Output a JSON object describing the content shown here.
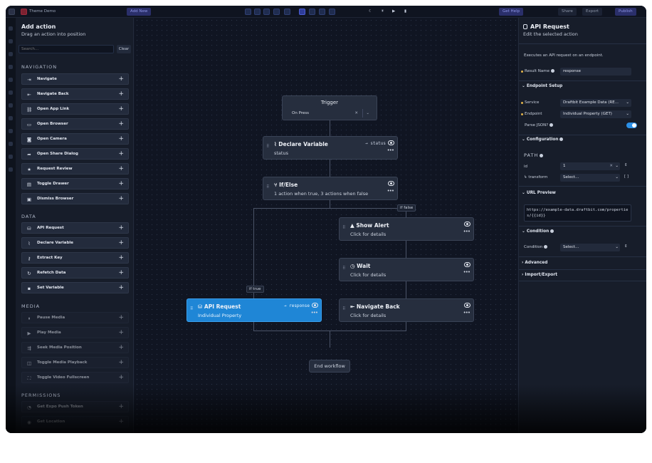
{
  "topbar": {
    "app_name": "Theme Demo",
    "add_new": "Add New",
    "get_help": "Get Help",
    "share": "Share",
    "export": "Export",
    "publish": "Publish"
  },
  "left_panel": {
    "title": "Add action",
    "subtitle": "Drag an action into position",
    "search_placeholder": "Search...",
    "clear_label": "Clear",
    "sections": {
      "navigation": "NAVIGATION",
      "data": "DATA",
      "media": "MEDIA",
      "permissions": "PERMISSIONS"
    },
    "navigation_items": [
      {
        "label": "Navigate",
        "icon": "arrow-right-bar-icon"
      },
      {
        "label": "Navigate Back",
        "icon": "arrow-left-bar-icon"
      },
      {
        "label": "Open App Link",
        "icon": "link-icon"
      },
      {
        "label": "Open Browser",
        "icon": "browser-icon"
      },
      {
        "label": "Open Camera",
        "icon": "camera-icon"
      },
      {
        "label": "Open Share Dialog",
        "icon": "share-icon"
      },
      {
        "label": "Request Review",
        "icon": "star-icon"
      },
      {
        "label": "Toggle Drawer",
        "icon": "drawer-icon"
      },
      {
        "label": "Dismiss Browser",
        "icon": "dismiss-icon"
      }
    ],
    "data_items": [
      {
        "label": "API Request",
        "icon": "database-icon"
      },
      {
        "label": "Declare Variable",
        "icon": "paperclip-icon"
      },
      {
        "label": "Extract Key",
        "icon": "key-icon"
      },
      {
        "label": "Refetch Data",
        "icon": "refresh-icon"
      },
      {
        "label": "Set Variable",
        "icon": "set-icon"
      }
    ],
    "media_items": [
      {
        "label": "Pause Media",
        "icon": "pause-icon"
      },
      {
        "label": "Play Media",
        "icon": "play-icon"
      },
      {
        "label": "Seek Media Position",
        "icon": "seek-icon"
      },
      {
        "label": "Toggle Media Playback",
        "icon": "playback-icon"
      },
      {
        "label": "Toggle Video Fullscreen",
        "icon": "fullscreen-icon"
      }
    ],
    "permission_items": [
      {
        "label": "Get Expo Push Token",
        "icon": "bell-icon"
      },
      {
        "label": "Get Location",
        "icon": "location-icon"
      }
    ]
  },
  "canvas": {
    "trigger": {
      "title": "Trigger",
      "value": "On Press"
    },
    "nodes": {
      "declare_variable": {
        "title": "Declare Variable",
        "sub": "status",
        "right": "status"
      },
      "if_else": {
        "title": "If/Else",
        "sub": "1 action when true, 3 actions when false"
      },
      "show_alert": {
        "title": "Show Alert",
        "sub": "Click for details"
      },
      "wait": {
        "title": "Wait",
        "sub": "Click for details"
      },
      "api_request": {
        "title": "API Request",
        "sub": "Individual Property",
        "right": "response"
      },
      "navigate_back": {
        "title": "Navigate Back",
        "sub": "Click for details"
      }
    },
    "edge_labels": {
      "if_false": "if false",
      "if_true": "if true"
    },
    "end_label": "End workflow"
  },
  "right_panel": {
    "title": "API Request",
    "subtitle": "Edit the selected action",
    "description": "Executes an API request on an endpoint.",
    "result_name_label": "Result Name",
    "result_name_value": "response",
    "endpoint_setup": "Endpoint Setup",
    "service_label": "Service",
    "service_value": "Draftbit Example Data (RE...",
    "endpoint_label": "Endpoint",
    "endpoint_value": "Individual Property (GET)",
    "parse_json_label": "Parse JSON?",
    "configuration": "Configuration",
    "path_label": "PATH",
    "id_label": "id",
    "id_value": "1",
    "transform_label": "↳ transform",
    "transform_value": "Select...",
    "url_preview": "URL Preview",
    "url_value": "https://example-data.draftbit.com/properties/{{id}}",
    "condition_section": "Condition",
    "condition_label": "Condition",
    "condition_value": "Select...",
    "advanced": "Advanced",
    "import_export": "Import/Export"
  },
  "colors": {
    "accent": "#1f86d6",
    "toggle": "#2b8fe6",
    "background": "#121826"
  }
}
